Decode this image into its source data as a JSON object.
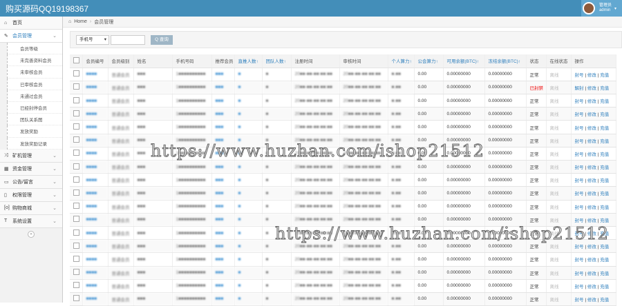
{
  "topbar": {
    "brand": "购买源码QQ19198367",
    "user_role": "管理员",
    "user_name": "admin"
  },
  "sidebar": {
    "items": [
      {
        "icon": "dashboard-icon",
        "glyph": "⌂",
        "label": "首页",
        "chev": false
      },
      {
        "icon": "edit-icon",
        "glyph": "✎",
        "label": "会员管理",
        "chev": true,
        "active": true,
        "children": [
          "会员等级",
          "未完善资料会员",
          "未审核会员",
          "已审核会员",
          "未通过会员",
          "已经封停会员",
          "团队关系图",
          "发放奖励",
          "发放奖励记录"
        ]
      },
      {
        "icon": "shuffle-icon",
        "glyph": "⤨",
        "label": "矿机管理",
        "chev": true
      },
      {
        "icon": "calendar-icon",
        "glyph": "▦",
        "label": "资金管理",
        "chev": true
      },
      {
        "icon": "card-icon",
        "glyph": "▭",
        "label": "公告/留言",
        "chev": true
      },
      {
        "icon": "file-icon",
        "glyph": "▯",
        "label": "权限管理",
        "chev": true
      },
      {
        "icon": "shop-icon",
        "glyph": "[o]",
        "label": "购物商城",
        "chev": true
      },
      {
        "icon": "text-icon",
        "glyph": "T",
        "label": "系统设置",
        "chev": true
      }
    ],
    "collapse": "«"
  },
  "breadcrumb": {
    "home": "Home",
    "sep": "›",
    "current": "会员管理"
  },
  "search": {
    "select_value": "手机号",
    "input_value": "",
    "button": "Q 查询"
  },
  "table": {
    "headers": [
      {
        "label": "会员编号",
        "sort": false
      },
      {
        "label": "会员级别",
        "sort": false
      },
      {
        "label": "姓名",
        "sort": false
      },
      {
        "label": "手机号码",
        "sort": false
      },
      {
        "label": "推荐会员",
        "sort": false
      },
      {
        "label": "直推人数↑",
        "sort": true
      },
      {
        "label": "团队人数↑",
        "sort": true
      },
      {
        "label": "注册时间",
        "sort": false
      },
      {
        "label": "审核时间",
        "sort": false
      },
      {
        "label": "个人算力↑",
        "sort": true
      },
      {
        "label": "公会算力↑",
        "sort": true
      },
      {
        "label": "可用余额(BTC)↑",
        "sort": true
      },
      {
        "label": "冻结余额(BTC)↑",
        "sort": true
      },
      {
        "label": "状态",
        "sort": false
      },
      {
        "label": "在线状态",
        "sort": false
      },
      {
        "label": "操作",
        "sort": false
      }
    ],
    "rows": [
      {
        "status": "正常",
        "online": "离线",
        "ban": "封号"
      },
      {
        "status": "已封禁",
        "online": "离线",
        "ban": "解封",
        "banned": true
      },
      {
        "status": "正常",
        "online": "离线",
        "ban": "封号"
      },
      {
        "status": "正常",
        "online": "离线",
        "ban": "封号"
      },
      {
        "status": "正常",
        "online": "离线",
        "ban": "封号"
      },
      {
        "status": "正常",
        "online": "离线",
        "ban": "封号"
      },
      {
        "status": "正常",
        "online": "离线",
        "ban": "封号"
      },
      {
        "status": "正常",
        "online": "离线",
        "ban": "封号"
      },
      {
        "status": "正常",
        "online": "离线",
        "ban": "封号"
      },
      {
        "status": "正常",
        "online": "离线",
        "ban": "封号"
      },
      {
        "status": "正常",
        "online": "离线",
        "ban": "封号"
      },
      {
        "status": "正常",
        "online": "离线",
        "ban": "封号"
      },
      {
        "status": "正常",
        "online": "离线",
        "ban": "封号"
      },
      {
        "status": "正常",
        "online": "离线",
        "ban": "封号"
      },
      {
        "status": "正常",
        "online": "离线",
        "ban": "封号"
      },
      {
        "status": "正常",
        "online": "离线",
        "ban": "封号"
      },
      {
        "status": "正常",
        "online": "离线",
        "ban": "封号"
      },
      {
        "status": "正常",
        "online": "离线",
        "ban": "封号"
      }
    ],
    "defaults": {
      "id": "■■■■",
      "level": "普通会员",
      "name": "■■■",
      "phone": "1■■■■■■■■■■",
      "referrer": "■■■",
      "direct": "■",
      "team": "■",
      "reg_time": "20■■-■■-■■ ■■:■■",
      "audit_time": "20■■-■■-■■ ■■:■■",
      "personal": "■.■■",
      "guild": "0.00",
      "available": "0.00000000",
      "frozen": "0.00000000",
      "edit": "修改",
      "recharge": "充值",
      "sep": "|"
    }
  },
  "watermark": "https://www.huzhan.com/ishop21512"
}
